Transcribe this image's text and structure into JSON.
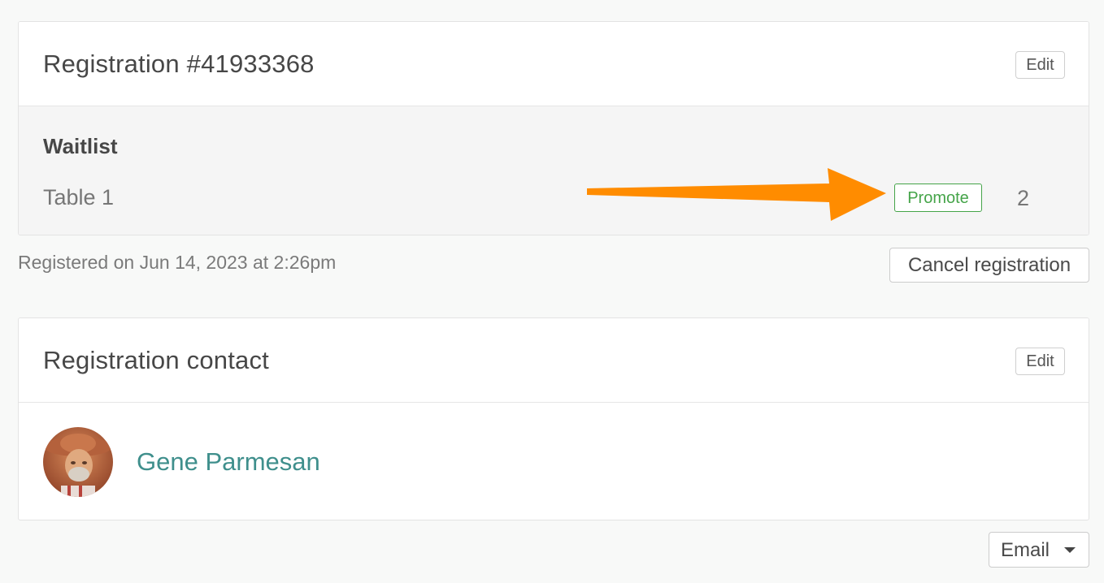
{
  "registration": {
    "title": "Registration #41933368",
    "edit_label": "Edit",
    "waitlist": {
      "heading": "Waitlist",
      "table_label": "Table 1",
      "promote_label": "Promote",
      "count": "2"
    },
    "registered_on": "Registered on Jun 14, 2023 at 2:26pm",
    "cancel_label": "Cancel registration"
  },
  "contact": {
    "title": "Registration contact",
    "edit_label": "Edit",
    "name": "Gene Parmesan",
    "avatar_icon": "avatar-photo"
  },
  "actions": {
    "email_label": "Email",
    "email_icon": "caret-down-icon"
  },
  "annotation": {
    "arrow_color": "#ff8c00",
    "arrow_icon": "arrow-right-icon"
  },
  "colors": {
    "accent_teal": "#3f8f8c",
    "promote_green": "#45a449",
    "background": "#f8f9f8"
  }
}
